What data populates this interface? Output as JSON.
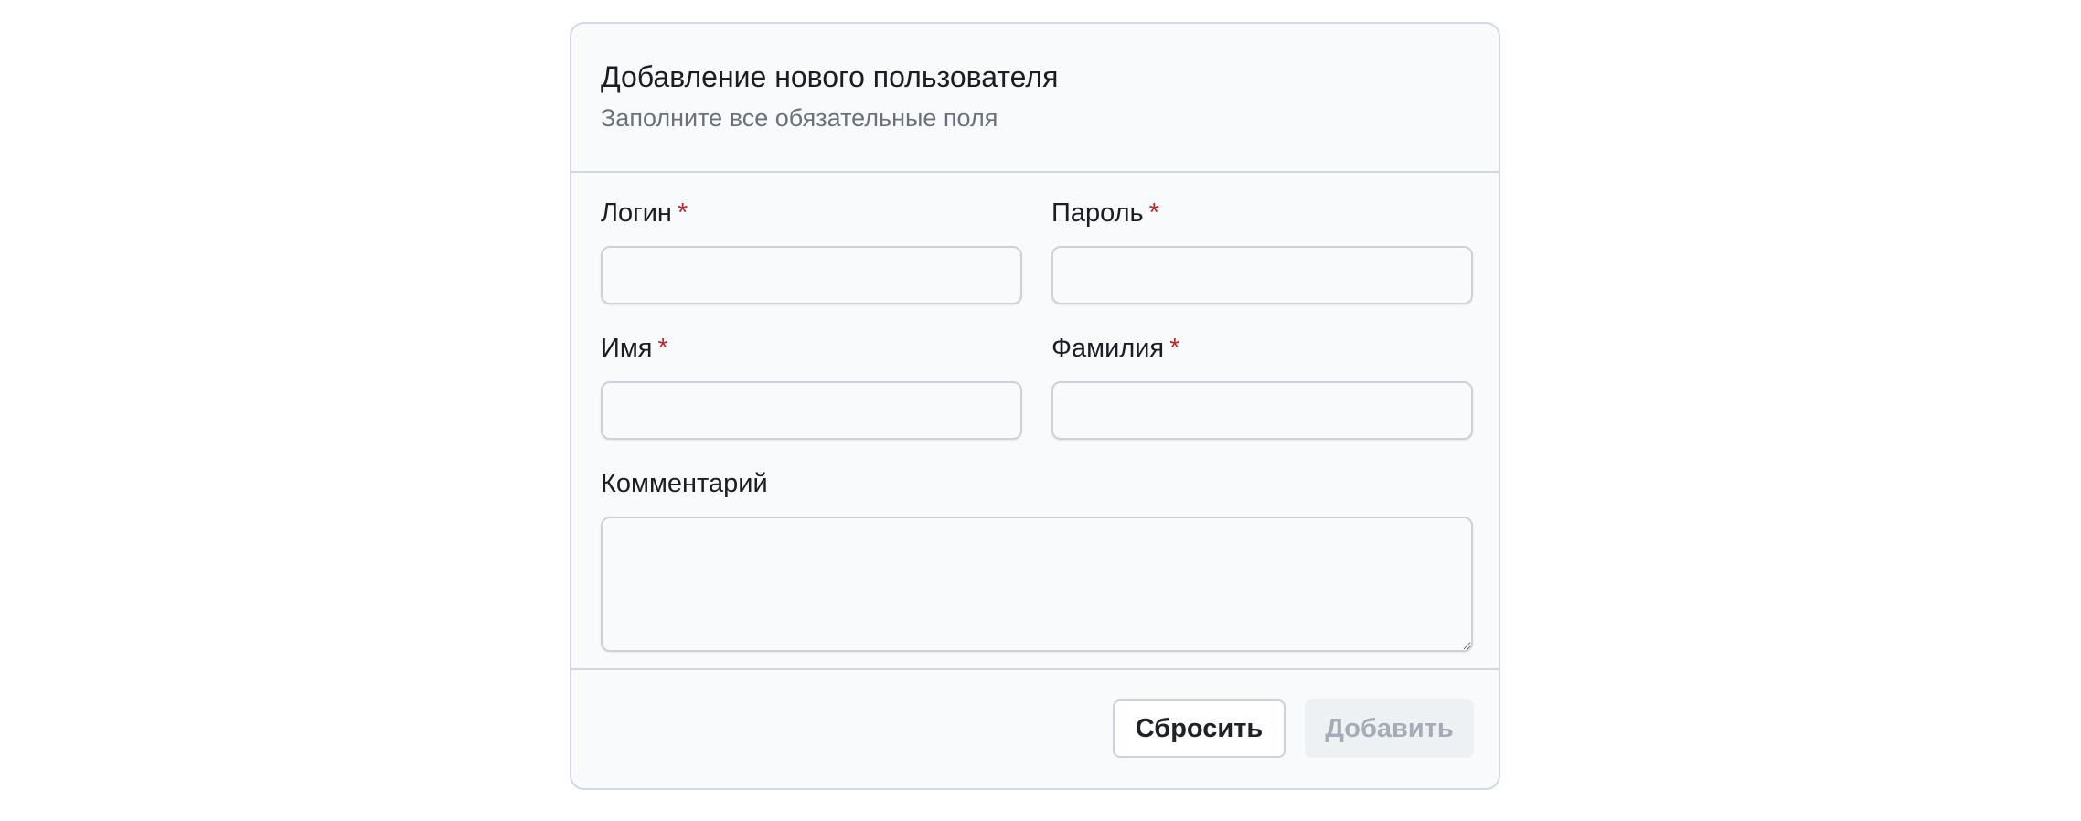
{
  "form": {
    "title": "Добавление нового пользователя",
    "subtitle": "Заполните все обязательные поля",
    "required_mark": "*",
    "fields": {
      "login": {
        "label": "Логин",
        "value": "",
        "required": true
      },
      "password": {
        "label": "Пароль",
        "value": "",
        "required": true
      },
      "first_name": {
        "label": "Имя",
        "value": "",
        "required": true
      },
      "last_name": {
        "label": "Фамилия",
        "value": "",
        "required": true
      },
      "comment": {
        "label": "Комментарий",
        "value": "",
        "required": false
      }
    },
    "buttons": {
      "reset_label": "Сбросить",
      "add_label": "Добавить"
    }
  },
  "colors": {
    "card_background": "#f9fafc",
    "border": "#d3d9e2",
    "required_mark": "#c0272d",
    "disabled_button_text": "#a6acb5"
  }
}
